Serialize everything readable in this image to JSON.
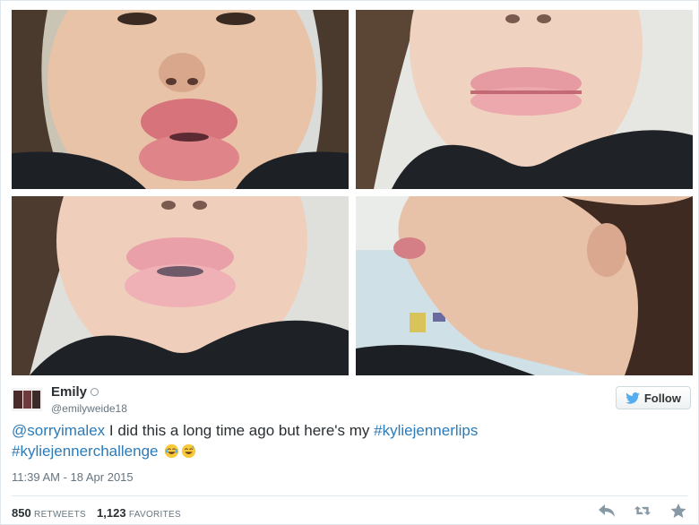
{
  "photos": [
    {
      "subject": "front-view-lips-1"
    },
    {
      "subject": "front-view-lips-2"
    },
    {
      "subject": "front-view-lips-3"
    },
    {
      "subject": "side-profile-lips"
    }
  ],
  "user": {
    "name": "Emily",
    "handle": "@emilyweide18"
  },
  "follow_label": "Follow",
  "tweet": {
    "mention": "@sorryimalex",
    "text": " I did this a long time ago but here's my ",
    "hashtag1": "#kyliejennerlips",
    "hashtag2": "#kyliejennerchallenge",
    "emojis": [
      "face-with-tears-of-joy",
      "smiling-face-with-sweat"
    ]
  },
  "timestamp": "11:39 AM - 18 Apr 2015",
  "stats": {
    "retweets_count": "850",
    "retweets_label": "RETWEETS",
    "favorites_count": "1,123",
    "favorites_label": "FAVORITES"
  },
  "colors": {
    "link": "#2b7bb9",
    "text": "#292f33",
    "muted": "#66757f",
    "twitter_blue": "#55acee"
  },
  "icons": [
    "reply-icon",
    "retweet-icon",
    "favorite-icon",
    "twitter-bird-icon"
  ]
}
